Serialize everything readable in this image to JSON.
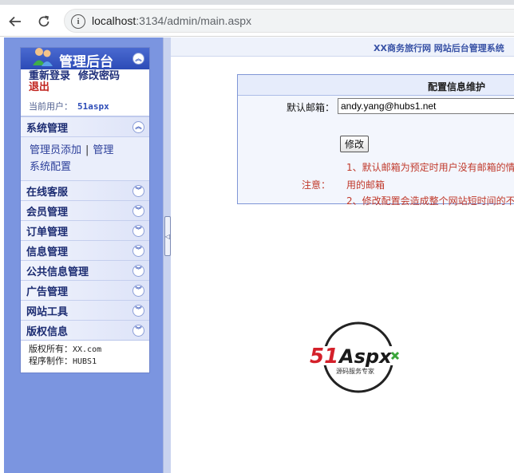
{
  "browser": {
    "url_host": "localhost",
    "url_rest": ":3134/admin/main.aspx",
    "info_glyph": "i"
  },
  "sidebar": {
    "title": "管理后台",
    "relogin": "重新登录",
    "change_password": "修改密码",
    "logout": "退出",
    "current_user_label": "当前用户：",
    "current_user": "51aspx",
    "sections": [
      {
        "label": "系统管理",
        "expanded": true,
        "links": [
          "管理员添加",
          "管理",
          "系统配置"
        ]
      },
      {
        "label": "在线客服"
      },
      {
        "label": "会员管理"
      },
      {
        "label": "订单管理"
      },
      {
        "label": "信息管理"
      },
      {
        "label": "公共信息管理"
      },
      {
        "label": "广告管理"
      },
      {
        "label": "网站工具"
      },
      {
        "label": "版权信息"
      }
    ],
    "copyright_owner_label": "版权所有：",
    "copyright_owner": "XX.com",
    "copyright_maker_label": "程序制作：",
    "copyright_maker": "HUBS1"
  },
  "main": {
    "header_title": "XX商务旅行网 网站后台管理系统",
    "panel_title": "配置信息维护",
    "email_label": "默认邮箱：",
    "email_value": "andy.yang@hubs1.net",
    "submit_label": "修改",
    "note_label": "注意：",
    "notes": [
      "1、默认邮箱为预定时用户没有邮箱的情",
      "用的邮箱",
      "2、修改配置会造成整个网站短时间的不"
    ]
  },
  "logo_text": {
    "brand": "51Aspx",
    "tagline": "源码服务专家"
  },
  "colors": {
    "sidebar_bg": "#7b95e0",
    "menu_header": "#2c4bb7",
    "note_red": "#c0392b",
    "logo_red": "#d4202a",
    "logo_green": "#3aa53a"
  }
}
